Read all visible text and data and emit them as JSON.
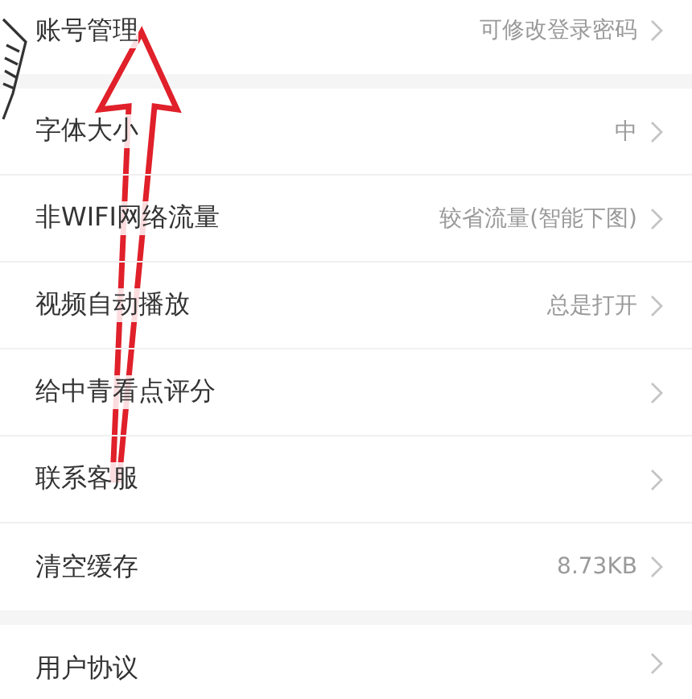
{
  "sections": [
    {
      "items": [
        {
          "label": "账号管理",
          "value": "可修改登录密码"
        }
      ]
    },
    {
      "items": [
        {
          "label": "字体大小",
          "value": "中"
        },
        {
          "label": "非WIFI网络流量",
          "value": "较省流量(智能下图)"
        },
        {
          "label": "视频自动播放",
          "value": "总是打开"
        },
        {
          "label": "给中青看点评分"
        },
        {
          "label": "联系客服"
        },
        {
          "label": "清空缓存",
          "value": "8.73KB"
        }
      ]
    },
    {
      "items": [
        {
          "label": "用户协议"
        }
      ]
    }
  ]
}
